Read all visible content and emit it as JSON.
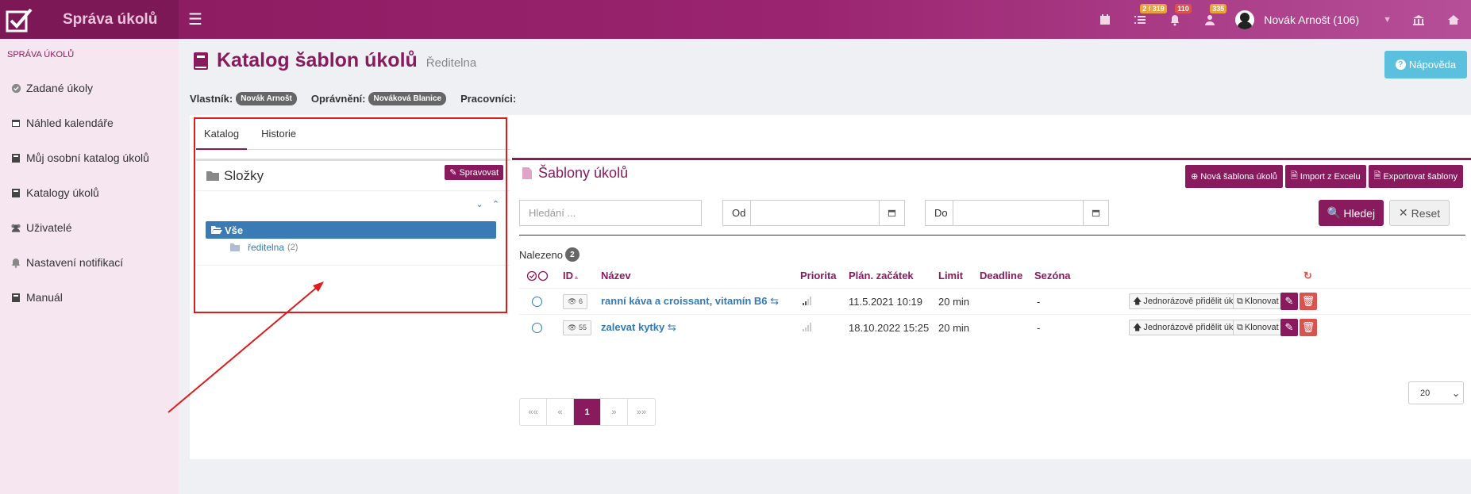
{
  "app": {
    "title": "Správa úkolů"
  },
  "topbar": {
    "badge_tasks": "2 / 319",
    "badge_notifications": "110",
    "badge_alerts": "335",
    "user_name": "Novák Arnošt (106)"
  },
  "sidebar": {
    "heading": "SPRÁVA ÚKOLŮ",
    "items": [
      {
        "label": "Zadané úkoly"
      },
      {
        "label": "Náhled kalendáře"
      },
      {
        "label": "Můj osobní katalog úkolů"
      },
      {
        "label": "Katalogy úkolů"
      },
      {
        "label": "Uživatelé"
      },
      {
        "label": "Nastavení notifikací"
      },
      {
        "label": "Manuál"
      }
    ]
  },
  "page": {
    "title": "Katalog šablon úkolů",
    "subtitle": "Ředitelna",
    "help": "Nápověda",
    "owner_label": "Vlastník:",
    "owner": "Novák Arnošt",
    "permission_label": "Oprávnění:",
    "permission": "Nováková Blanice",
    "workers_label": "Pracovníci:"
  },
  "tabs": [
    {
      "label": "Katalog"
    },
    {
      "label": "Historie"
    }
  ],
  "folders": {
    "title": "Složky",
    "manage": "Spravovat",
    "all": "Vše",
    "child": "ředitelna",
    "child_count": "(2)"
  },
  "templates": {
    "title": "Šablony úkolů",
    "new": "Nová šablona úkolů",
    "import": "Import z Excelu",
    "export": "Exportovat šablony",
    "search_placeholder": "Hledání ...",
    "from": "Od",
    "to": "Do",
    "search_btn": "Hledej",
    "reset_btn": "Reset",
    "found_label": "Nalezeno",
    "found_count": "2",
    "columns": {
      "id": "ID",
      "name": "Název",
      "priority": "Priorita",
      "start": "Plán. začátek",
      "limit": "Limit",
      "deadline": "Deadline",
      "season": "Sezóna"
    },
    "rows": [
      {
        "views": "6",
        "name": "ranní káva a croissant, vitamín B6",
        "start": "11.5.2021 10:19",
        "limit": "20 min",
        "season": "-"
      },
      {
        "views": "55",
        "name": "zalevat kytky",
        "start": "18.10.2022 15:25",
        "limit": "20 min",
        "season": "-"
      }
    ],
    "row_assign": "Jednorázově přidělit úkol",
    "row_clone": "Klonovat",
    "pager": [
      "««",
      "«",
      "1",
      "»",
      "»»"
    ],
    "per_page": "20"
  }
}
